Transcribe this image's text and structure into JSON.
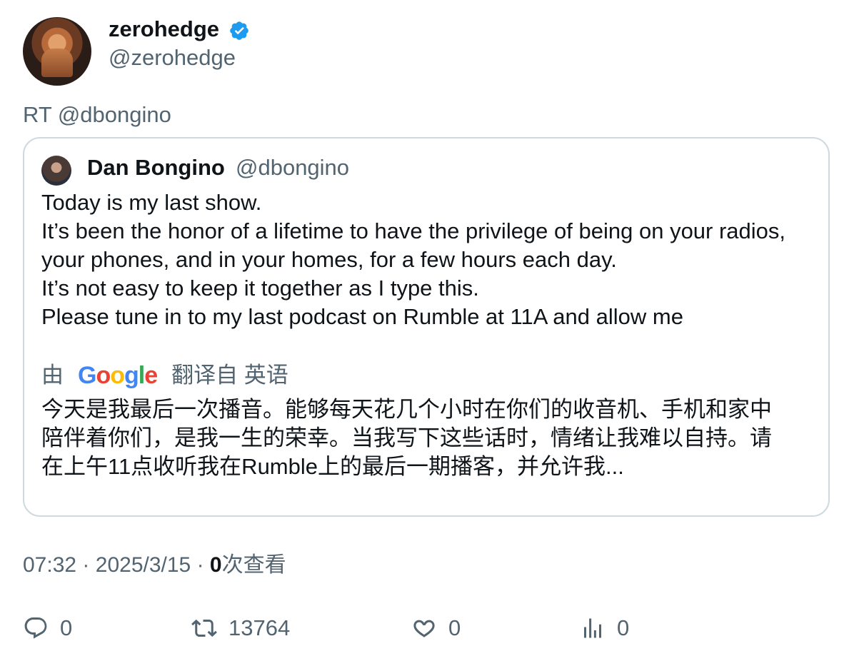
{
  "author": {
    "name": "zerohedge",
    "handle": "@zerohedge",
    "verified_icon": "verified-badge-icon",
    "verified_color": "#1d9bf0"
  },
  "retweet_label": "RT @dbongino",
  "quoted": {
    "name": "Dan Bongino",
    "handle": "@dbongino",
    "lines": [
      "Today is my last show.",
      "It’s been the honor of a lifetime to have the privilege of being on your radios,",
      "your phones, and in your homes, for a few hours each day.",
      "It’s not easy to keep it together as I type this.",
      "Please tune in to my last podcast on Rumble at 11A and allow me"
    ],
    "translation_prefix": "由",
    "translation_brand": "Google",
    "translation_suffix": "翻译自 英语",
    "translated_lines": [
      "今天是我最后一次播音。能够每天花几个小时在你们的收音机、手机和家中",
      "陪伴着你们，是我一生的荣幸。当我写下这些话时，情绪让我难以自持。请",
      "在上午11点收听我在Rumble上的最后一期播客，并允许我..."
    ]
  },
  "meta": {
    "time": "07:32",
    "separator": "·",
    "date": "2025/3/15",
    "views_count": "0",
    "views_label": "次查看"
  },
  "actions": {
    "reply": {
      "icon": "reply-icon",
      "count": "0"
    },
    "retweet": {
      "icon": "retweet-icon",
      "count": "13764"
    },
    "like": {
      "icon": "heart-icon",
      "count": "0"
    },
    "views": {
      "icon": "analytics-icon",
      "count": "0"
    }
  },
  "colors": {
    "text_primary": "#0f1419",
    "text_secondary": "#536471",
    "border": "#cfd9de"
  }
}
